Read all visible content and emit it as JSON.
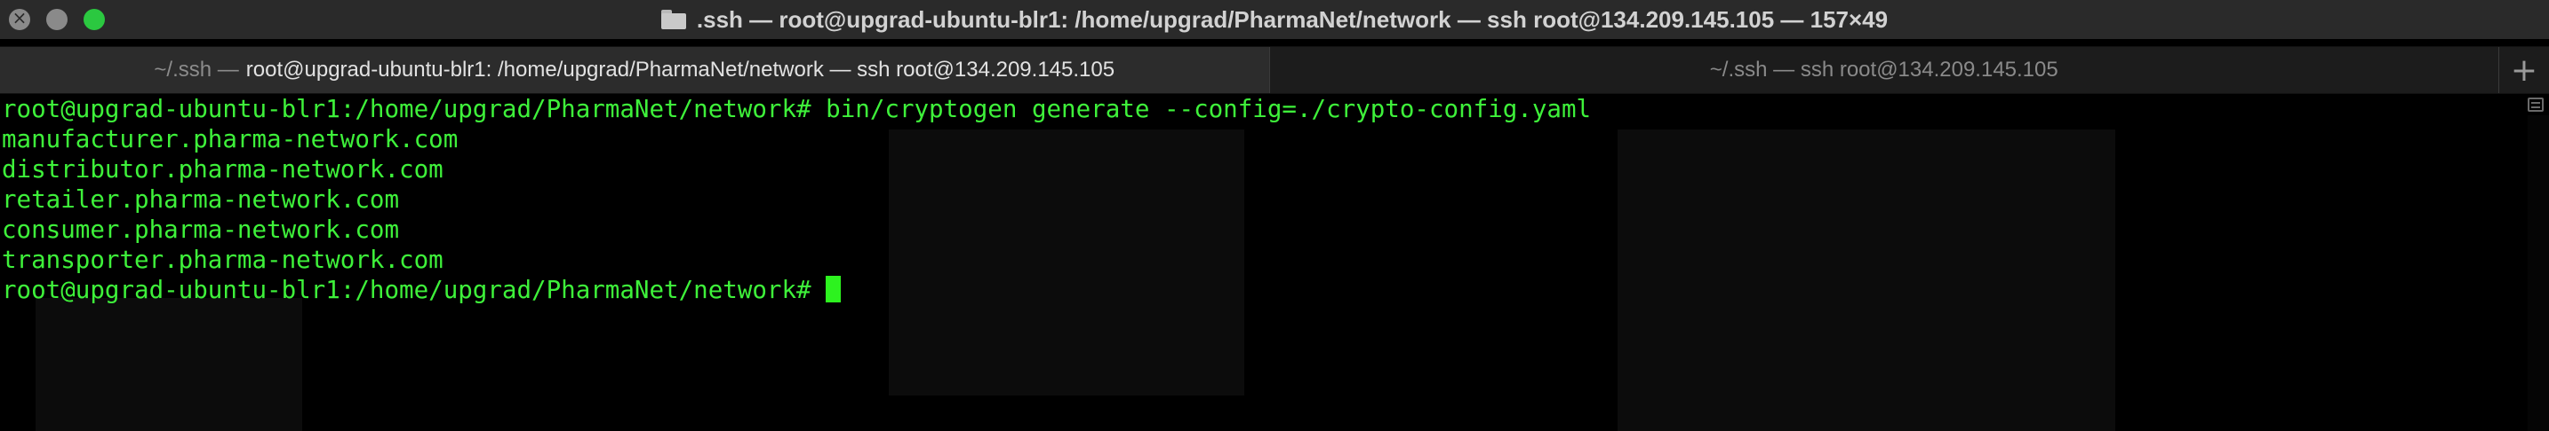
{
  "window": {
    "title": ".ssh — root@upgrad-ubuntu-blr1: /home/upgrad/PharmaNet/network — ssh root@134.209.145.105 — 157×49"
  },
  "tabs": [
    {
      "prefix": "~/.ssh —",
      "label": "root@upgrad-ubuntu-blr1: /home/upgrad/PharmaNet/network — ssh root@134.209.145.105",
      "active": true
    },
    {
      "label": "~/.ssh — ssh root@134.209.145.105",
      "active": false
    }
  ],
  "new_tab_label": "+",
  "terminal": {
    "lines": [
      "root@upgrad-ubuntu-blr1:/home/upgrad/PharmaNet/network# bin/cryptogen generate --config=./crypto-config.yaml",
      "manufacturer.pharma-network.com",
      "distributor.pharma-network.com",
      "retailer.pharma-network.com",
      "consumer.pharma-network.com",
      "transporter.pharma-network.com"
    ],
    "prompt": "root@upgrad-ubuntu-blr1:/home/upgrad/PharmaNet/network# ",
    "text_color": "#3ef13a",
    "cursor_color": "#2df21f"
  }
}
